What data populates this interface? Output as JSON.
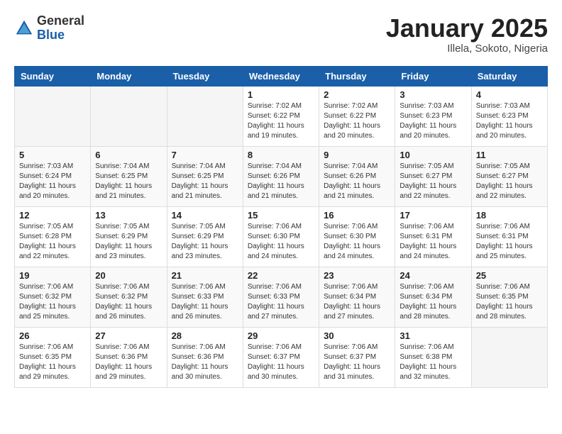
{
  "header": {
    "logo_general": "General",
    "logo_blue": "Blue",
    "title": "January 2025",
    "location": "Illela, Sokoto, Nigeria"
  },
  "calendar": {
    "days_of_week": [
      "Sunday",
      "Monday",
      "Tuesday",
      "Wednesday",
      "Thursday",
      "Friday",
      "Saturday"
    ],
    "weeks": [
      [
        {
          "day": "",
          "info": ""
        },
        {
          "day": "",
          "info": ""
        },
        {
          "day": "",
          "info": ""
        },
        {
          "day": "1",
          "info": "Sunrise: 7:02 AM\nSunset: 6:22 PM\nDaylight: 11 hours\nand 19 minutes."
        },
        {
          "day": "2",
          "info": "Sunrise: 7:02 AM\nSunset: 6:22 PM\nDaylight: 11 hours\nand 20 minutes."
        },
        {
          "day": "3",
          "info": "Sunrise: 7:03 AM\nSunset: 6:23 PM\nDaylight: 11 hours\nand 20 minutes."
        },
        {
          "day": "4",
          "info": "Sunrise: 7:03 AM\nSunset: 6:23 PM\nDaylight: 11 hours\nand 20 minutes."
        }
      ],
      [
        {
          "day": "5",
          "info": "Sunrise: 7:03 AM\nSunset: 6:24 PM\nDaylight: 11 hours\nand 20 minutes."
        },
        {
          "day": "6",
          "info": "Sunrise: 7:04 AM\nSunset: 6:25 PM\nDaylight: 11 hours\nand 21 minutes."
        },
        {
          "day": "7",
          "info": "Sunrise: 7:04 AM\nSunset: 6:25 PM\nDaylight: 11 hours\nand 21 minutes."
        },
        {
          "day": "8",
          "info": "Sunrise: 7:04 AM\nSunset: 6:26 PM\nDaylight: 11 hours\nand 21 minutes."
        },
        {
          "day": "9",
          "info": "Sunrise: 7:04 AM\nSunset: 6:26 PM\nDaylight: 11 hours\nand 21 minutes."
        },
        {
          "day": "10",
          "info": "Sunrise: 7:05 AM\nSunset: 6:27 PM\nDaylight: 11 hours\nand 22 minutes."
        },
        {
          "day": "11",
          "info": "Sunrise: 7:05 AM\nSunset: 6:27 PM\nDaylight: 11 hours\nand 22 minutes."
        }
      ],
      [
        {
          "day": "12",
          "info": "Sunrise: 7:05 AM\nSunset: 6:28 PM\nDaylight: 11 hours\nand 22 minutes."
        },
        {
          "day": "13",
          "info": "Sunrise: 7:05 AM\nSunset: 6:29 PM\nDaylight: 11 hours\nand 23 minutes."
        },
        {
          "day": "14",
          "info": "Sunrise: 7:05 AM\nSunset: 6:29 PM\nDaylight: 11 hours\nand 23 minutes."
        },
        {
          "day": "15",
          "info": "Sunrise: 7:06 AM\nSunset: 6:30 PM\nDaylight: 11 hours\nand 24 minutes."
        },
        {
          "day": "16",
          "info": "Sunrise: 7:06 AM\nSunset: 6:30 PM\nDaylight: 11 hours\nand 24 minutes."
        },
        {
          "day": "17",
          "info": "Sunrise: 7:06 AM\nSunset: 6:31 PM\nDaylight: 11 hours\nand 24 minutes."
        },
        {
          "day": "18",
          "info": "Sunrise: 7:06 AM\nSunset: 6:31 PM\nDaylight: 11 hours\nand 25 minutes."
        }
      ],
      [
        {
          "day": "19",
          "info": "Sunrise: 7:06 AM\nSunset: 6:32 PM\nDaylight: 11 hours\nand 25 minutes."
        },
        {
          "day": "20",
          "info": "Sunrise: 7:06 AM\nSunset: 6:32 PM\nDaylight: 11 hours\nand 26 minutes."
        },
        {
          "day": "21",
          "info": "Sunrise: 7:06 AM\nSunset: 6:33 PM\nDaylight: 11 hours\nand 26 minutes."
        },
        {
          "day": "22",
          "info": "Sunrise: 7:06 AM\nSunset: 6:33 PM\nDaylight: 11 hours\nand 27 minutes."
        },
        {
          "day": "23",
          "info": "Sunrise: 7:06 AM\nSunset: 6:34 PM\nDaylight: 11 hours\nand 27 minutes."
        },
        {
          "day": "24",
          "info": "Sunrise: 7:06 AM\nSunset: 6:34 PM\nDaylight: 11 hours\nand 28 minutes."
        },
        {
          "day": "25",
          "info": "Sunrise: 7:06 AM\nSunset: 6:35 PM\nDaylight: 11 hours\nand 28 minutes."
        }
      ],
      [
        {
          "day": "26",
          "info": "Sunrise: 7:06 AM\nSunset: 6:35 PM\nDaylight: 11 hours\nand 29 minutes."
        },
        {
          "day": "27",
          "info": "Sunrise: 7:06 AM\nSunset: 6:36 PM\nDaylight: 11 hours\nand 29 minutes."
        },
        {
          "day": "28",
          "info": "Sunrise: 7:06 AM\nSunset: 6:36 PM\nDaylight: 11 hours\nand 30 minutes."
        },
        {
          "day": "29",
          "info": "Sunrise: 7:06 AM\nSunset: 6:37 PM\nDaylight: 11 hours\nand 30 minutes."
        },
        {
          "day": "30",
          "info": "Sunrise: 7:06 AM\nSunset: 6:37 PM\nDaylight: 11 hours\nand 31 minutes."
        },
        {
          "day": "31",
          "info": "Sunrise: 7:06 AM\nSunset: 6:38 PM\nDaylight: 11 hours\nand 32 minutes."
        },
        {
          "day": "",
          "info": ""
        }
      ]
    ]
  }
}
